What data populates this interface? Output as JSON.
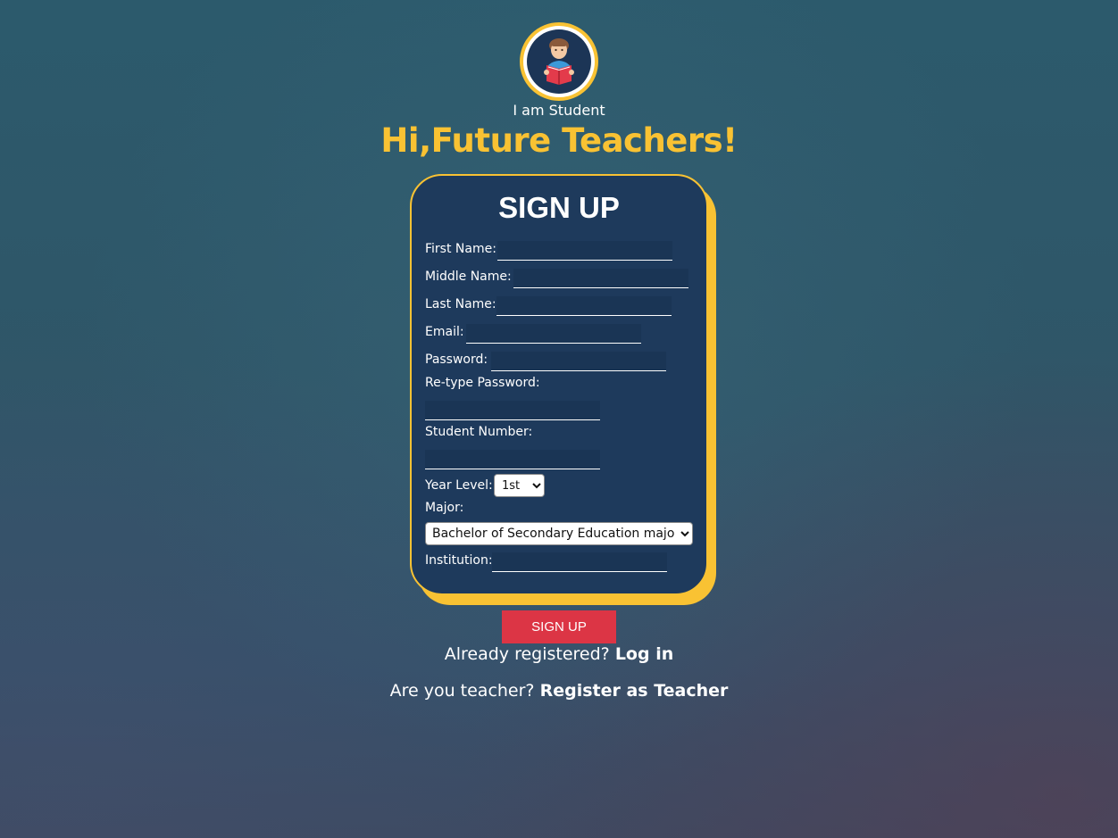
{
  "header": {
    "role_label": "I am Student",
    "headline": "Hi,Future Teachers!"
  },
  "form": {
    "title": "SIGN UP",
    "first_name_label": "First Name:",
    "middle_name_label": "Middle Name:",
    "last_name_label": "Last Name:",
    "email_label": "Email:",
    "password_label": "Password:",
    "retype_password_label": "Re-type Password:",
    "student_number_label": "Student Number:",
    "year_level_label": "Year Level:",
    "year_level_selected": "1st",
    "major_label": "Major:",
    "major_selected": "Bachelor of Secondary Education major",
    "institution_label": "Institution:",
    "submit_label": "SIGN UP"
  },
  "footer": {
    "login_prompt": "Already registered?",
    "login_link": "Log in",
    "teacher_prompt": "Are you teacher?",
    "teacher_link": "Register as Teacher"
  },
  "colors": {
    "accent": "#f9c233",
    "card": "#1e3a5c",
    "submit": "#dc3545"
  },
  "icons": {
    "avatar": "student-reading-icon",
    "dropdown": "chevron-down-icon"
  }
}
